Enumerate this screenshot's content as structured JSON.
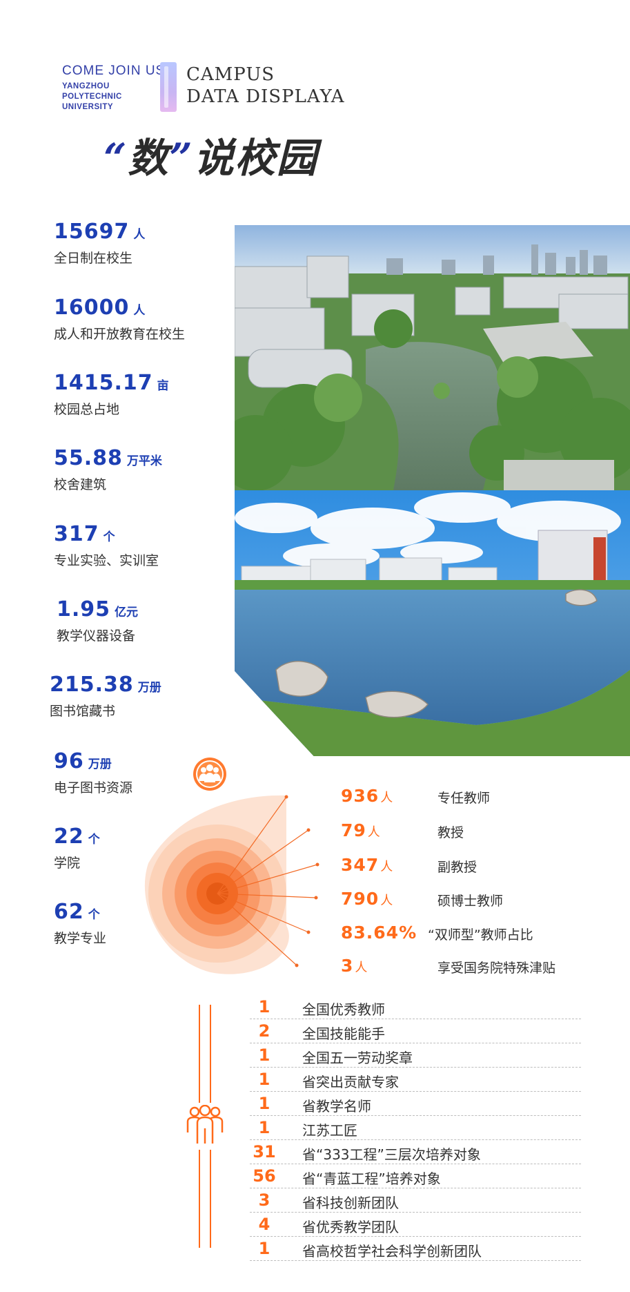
{
  "header": {
    "come_join": "COME JOIN US",
    "school_lines": [
      "YANGZHOU",
      "POLYTECHNIC",
      "UNIVERSITY"
    ],
    "title_lines": [
      "CAMPUS",
      "DATA DISPLAYA"
    ],
    "slogan_quote_open": "“",
    "slogan_char1": "数",
    "slogan_quote_close": "”",
    "slogan_rest": "说校园"
  },
  "stats": [
    {
      "value": "15697",
      "unit": "人",
      "label": "全日制在校生"
    },
    {
      "value": "16000",
      "unit": "人",
      "label": "成人和开放教育在校生"
    },
    {
      "value": "1415.17",
      "unit": "亩",
      "label": "校园总占地"
    },
    {
      "value": "55.88",
      "unit": "万平米",
      "label": "校舍建筑"
    },
    {
      "value": "317",
      "unit": "个",
      "label": "专业实验、实训室"
    },
    {
      "value": "1.95",
      "unit": "亿元",
      "label": "教学仪器设备"
    },
    {
      "value": "215.38",
      "unit": "万册",
      "label": "图书馆藏书"
    },
    {
      "value": "96",
      "unit": "万册",
      "label": "电子图书资源"
    },
    {
      "value": "22",
      "unit": "个",
      "label": "学院"
    },
    {
      "value": "62",
      "unit": "个",
      "label": "教学专业"
    }
  ],
  "faculty": [
    {
      "value": "936",
      "unit": "人",
      "label": "专任教师"
    },
    {
      "value": "79",
      "unit": "人",
      "label": "教授"
    },
    {
      "value": "347",
      "unit": "人",
      "label": "副教授"
    },
    {
      "value": "790",
      "unit": "人",
      "label": "硕博士教师"
    },
    {
      "value": "83.64%",
      "unit": "",
      "label": "“双师型”教师占比"
    },
    {
      "value": "3",
      "unit": "人",
      "label": "享受国务院特殊津贴"
    }
  ],
  "honors": [
    {
      "count": "1",
      "label": "全国优秀教师"
    },
    {
      "count": "2",
      "label": "全国技能能手"
    },
    {
      "count": "1",
      "label": "全国五一劳动奖章"
    },
    {
      "count": "1",
      "label": "省突出贡献专家"
    },
    {
      "count": "1",
      "label": "省教学名师"
    },
    {
      "count": "1",
      "label": "江苏工匠"
    },
    {
      "count": "31",
      "label": "省“333工程”三层次培养对象"
    },
    {
      "count": "56",
      "label": "省“青蓝工程”培养对象"
    },
    {
      "count": "3",
      "label": "省科技创新团队"
    },
    {
      "count": "4",
      "label": "省优秀教学团队"
    },
    {
      "count": "1",
      "label": "省高校哲学社会科学创新团队"
    }
  ],
  "colors": {
    "blue": "#1d3fb3",
    "orange": "#ff6a1a"
  },
  "icons": [
    "faculty-people-icon",
    "team-people-icon"
  ]
}
